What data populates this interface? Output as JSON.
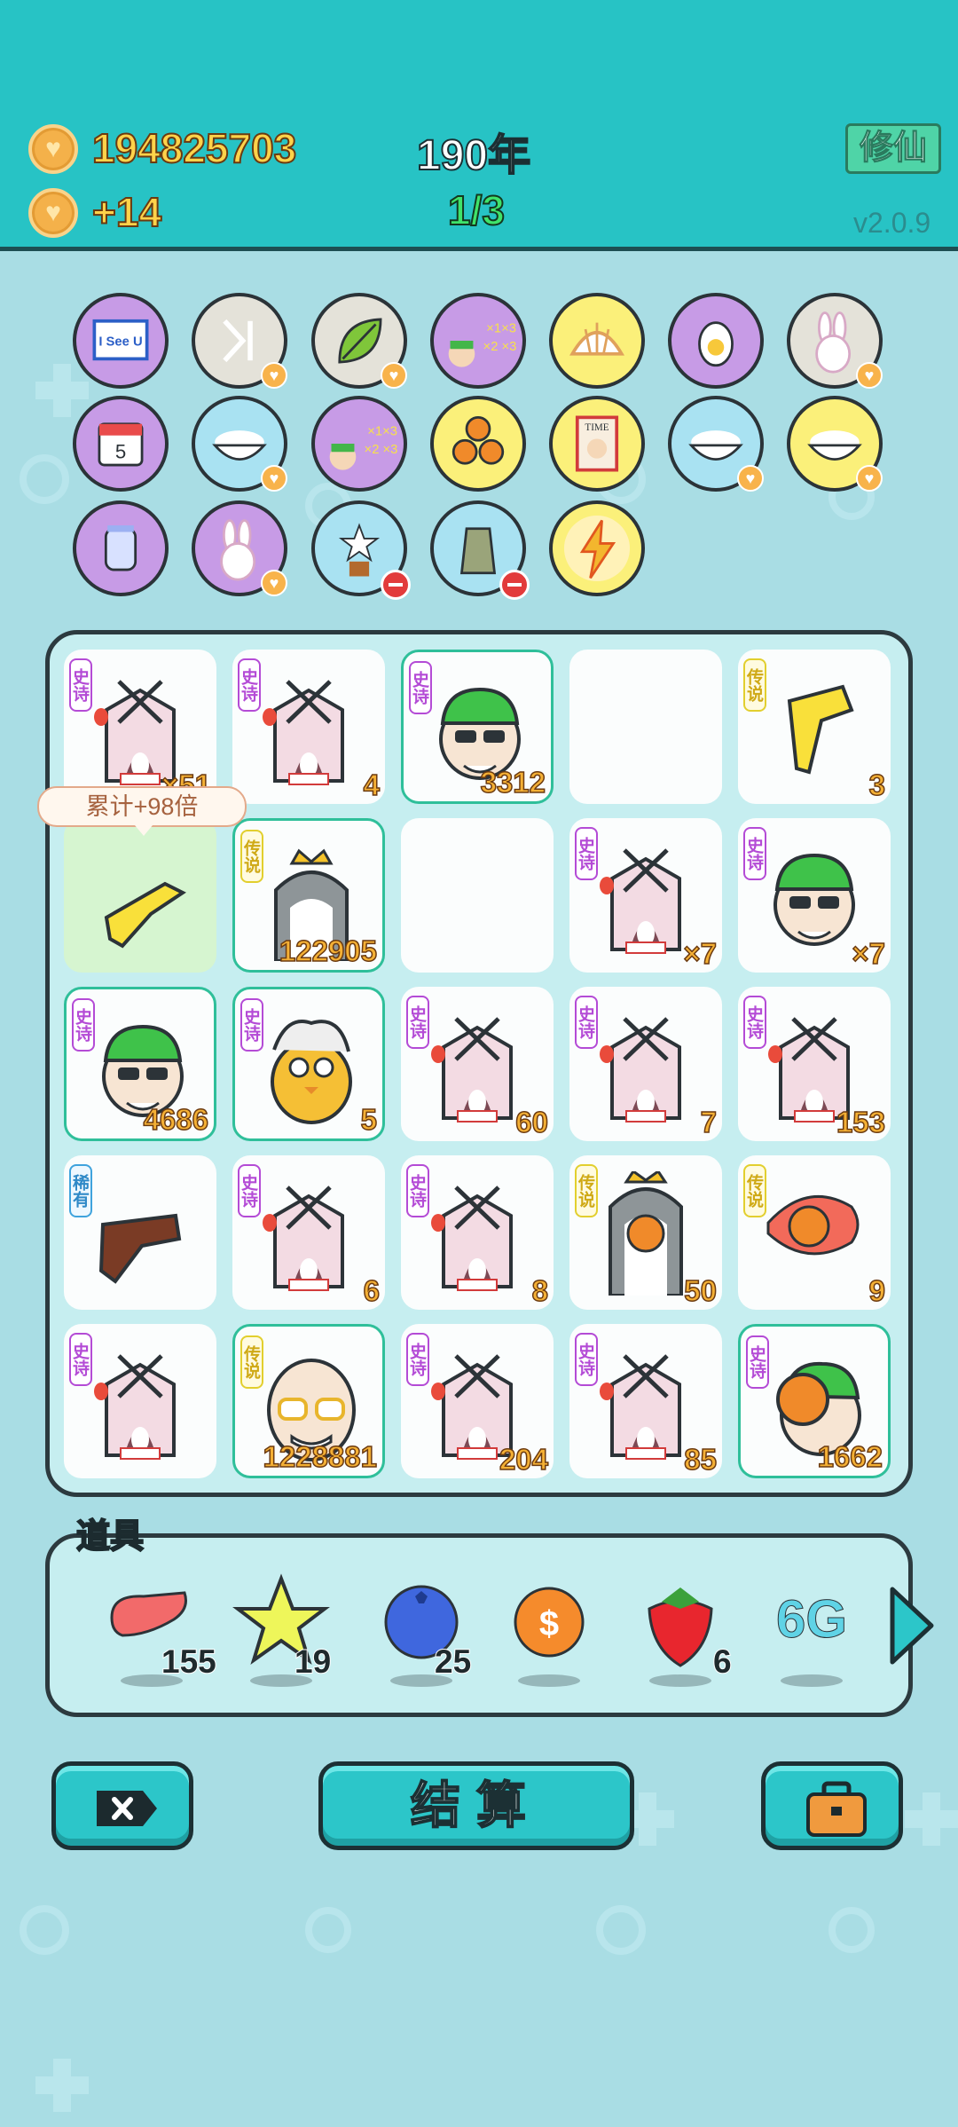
{
  "header": {
    "coins": "194825703",
    "income": "+14",
    "year": "190年",
    "round": "1/3",
    "cultivate_button": "修仙",
    "version": "v2.0.9"
  },
  "relics": [
    {
      "icon": "i-see-u-icon",
      "label": "I See U",
      "bg": "#c79be6"
    },
    {
      "icon": "skip-icon",
      "bg": "#e4e2d9",
      "heart": true
    },
    {
      "icon": "leaf-icon",
      "bg": "#e4e2d9",
      "heart": true
    },
    {
      "icon": "math-head-icon",
      "bg": "#c79be6"
    },
    {
      "icon": "shell-icon",
      "bg": "#fbf07a"
    },
    {
      "icon": "egg-icon",
      "bg": "#c79be6"
    },
    {
      "icon": "bunny-icon",
      "bg": "#e4e2d9",
      "heart": true
    },
    {
      "icon": "calendar-icon",
      "label": "5",
      "bg": "#c79be6"
    },
    {
      "icon": "rice-bowl-icon",
      "bg": "#a9e2f2",
      "heart": true
    },
    {
      "icon": "math-head-icon",
      "bg": "#c79be6"
    },
    {
      "icon": "basketballs-icon",
      "bg": "#fbf07a"
    },
    {
      "icon": "time-magazine-icon",
      "label": "TIME",
      "bg": "#fbf07a"
    },
    {
      "icon": "rice-bowl-icon",
      "bg": "#a9e2f2",
      "heart": true
    },
    {
      "icon": "rice-bowl-icon",
      "bg": "#fbf07a",
      "heart": true
    },
    {
      "icon": "milk-jar-icon",
      "bg": "#c79be6"
    },
    {
      "icon": "bunny-icon",
      "bg": "#c79be6",
      "heart": true
    },
    {
      "icon": "flower-pot-icon",
      "bg": "#a9e2f2",
      "minus": true
    },
    {
      "icon": "sack-icon",
      "bg": "#a9e2f2",
      "minus": true
    },
    {
      "icon": "lightning-icon",
      "bg": "#fbf07a"
    }
  ],
  "tooltip": "累计+98倍",
  "board": [
    {
      "tag": "史诗",
      "tagType": "epic",
      "art": "tent-bunny",
      "count": "×51"
    },
    {
      "tag": "史诗",
      "tagType": "epic",
      "art": "tent-bunny",
      "count": "4"
    },
    {
      "tag": "史诗",
      "tagType": "epic",
      "art": "green-hair-guy",
      "count": "3312",
      "hl": true
    },
    {
      "tag": "",
      "art": "",
      "count": ""
    },
    {
      "tag": "传说",
      "tagType": "leg",
      "art": "yellow-hand-down",
      "count": "3"
    },
    {
      "tag": "",
      "art": "yellow-hand-point",
      "count": "",
      "green": true
    },
    {
      "tag": "传说",
      "tagType": "leg",
      "art": "husky-king",
      "count": "122905",
      "hl": true
    },
    {
      "tag": "",
      "art": "",
      "count": ""
    },
    {
      "tag": "史诗",
      "tagType": "epic",
      "art": "tent-bunny",
      "count": "×7"
    },
    {
      "tag": "史诗",
      "tagType": "epic",
      "art": "green-hair-guy",
      "count": "×7"
    },
    {
      "tag": "史诗",
      "tagType": "epic",
      "art": "green-hair-guy",
      "count": "4686",
      "hl": true
    },
    {
      "tag": "史诗",
      "tagType": "epic",
      "art": "chick-grandpa",
      "count": "5",
      "hl": true
    },
    {
      "tag": "史诗",
      "tagType": "epic",
      "art": "tent-bunny",
      "count": "60"
    },
    {
      "tag": "史诗",
      "tagType": "epic",
      "art": "tent-bunny",
      "count": "7"
    },
    {
      "tag": "史诗",
      "tagType": "epic",
      "art": "tent-bunny",
      "count": "153"
    },
    {
      "tag": "稀有",
      "tagType": "rare",
      "art": "brown-hand",
      "count": ""
    },
    {
      "tag": "史诗",
      "tagType": "epic",
      "art": "tent-bunny",
      "count": "6"
    },
    {
      "tag": "史诗",
      "tagType": "epic",
      "art": "tent-bunny",
      "count": "8"
    },
    {
      "tag": "传说",
      "tagType": "leg",
      "art": "husky-basketball",
      "count": "50"
    },
    {
      "tag": "传说",
      "tagType": "leg",
      "art": "koi-basketball",
      "count": "9"
    },
    {
      "tag": "史诗",
      "tagType": "epic",
      "art": "tent-bunny",
      "count": ""
    },
    {
      "tag": "传说",
      "tagType": "leg",
      "art": "bald-grandpa",
      "count": "1228881",
      "hl": true
    },
    {
      "tag": "史诗",
      "tagType": "epic",
      "art": "tent-bunny",
      "count": "204"
    },
    {
      "tag": "史诗",
      "tagType": "epic",
      "art": "tent-bunny",
      "count": "85"
    },
    {
      "tag": "史诗",
      "tagType": "epic",
      "art": "basketball-guy",
      "count": "1662",
      "hl": true
    }
  ],
  "props": {
    "title": "道具",
    "items": [
      {
        "icon": "liver-icon",
        "count": "155"
      },
      {
        "icon": "star-icon",
        "count": "19"
      },
      {
        "icon": "blueberry-icon",
        "count": "25"
      },
      {
        "icon": "dollar-coin-icon",
        "count": ""
      },
      {
        "icon": "strawberry-icon",
        "count": "6"
      },
      {
        "icon": "6g-icon",
        "label": "6G",
        "count": ""
      }
    ]
  },
  "buttons": {
    "close_label": "",
    "settle_label": "结算",
    "bag_label": ""
  }
}
